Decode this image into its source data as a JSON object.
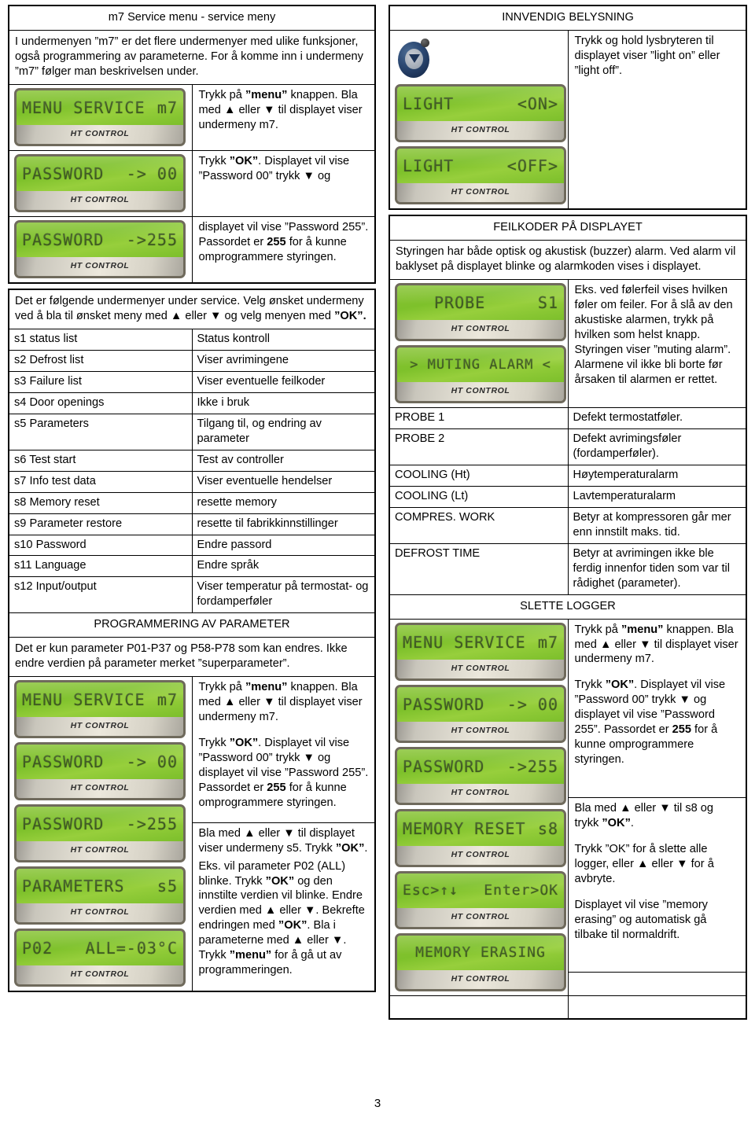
{
  "page_number": "3",
  "left": {
    "section_m7": {
      "title": "m7 Service menu - service meny",
      "intro": "I undermenyen ”m7” er det flere undermenyer med ulike funksjoner, også programmering av parameterne. For å komme inn i undermeny ”m7” følger man beskrivelsen under.",
      "step1_text_a": "Trykk på ",
      "step1_bold": "”menu”",
      "step1_text_b": " knappen. Bla med ▲ eller ▼ til displayet viser undermeny m7.",
      "step2_prefix": "Trykk ",
      "step2_bold": "”OK”",
      "step2_rest": ". Displayet vil vise ”Password 00” trykk ▼ og",
      "step3_a": "displayet vil vise ”Password 255”. Passordet er ",
      "step3_bold": "255",
      "step3_b": " for å kunne omprogrammere styringen.",
      "lcds": [
        {
          "left": "MENU SERVICE",
          "right": "m7",
          "brand": "HT CONTROL"
        },
        {
          "left": "PASSWORD",
          "right": "-> 00",
          "brand": "HT CONTROL"
        },
        {
          "left": "PASSWORD",
          "right": "->255",
          "brand": "HT CONTROL"
        }
      ]
    },
    "submenu_intro_a": "Det er følgende undermenyer under service. Velg ønsket undermeny ved å bla til ønsket meny med  ▲ eller ▼ og velg menyen med ",
    "submenu_intro_bold": "”OK”.",
    "submenu_rows": [
      {
        "code": "s1 status list",
        "desc": "Status kontroll",
        "bold": false
      },
      {
        "code": "s2 Defrost list",
        "desc": "Viser avrimingene",
        "bold": false
      },
      {
        "code": "s3 Failure list",
        "desc": "Viser eventuelle feilkoder",
        "bold": false
      },
      {
        "code": "s4 Door openings",
        "desc": "Ikke i bruk",
        "bold": false
      },
      {
        "code": "s5 Parameters",
        "desc": "Tilgang til, og endring av parameter",
        "bold": true
      },
      {
        "code": "s6 Test start",
        "desc": "Test av controller",
        "bold": false
      },
      {
        "code": "s7 Info test data",
        "desc": "Viser eventuelle hendelser",
        "bold": false
      },
      {
        "code": "s8 Memory reset",
        "desc": "resette memory",
        "bold": false
      },
      {
        "code": "s9 Parameter restore",
        "desc": "resette til fabrikkinnstillinger",
        "bold": false
      },
      {
        "code": "s10 Password",
        "desc": "Endre passord",
        "bold": false
      },
      {
        "code": "s11 Language",
        "desc": "Endre språk",
        "bold": false
      },
      {
        "code": "s12 Input/output",
        "desc": "Viser temperatur på termostat- og fordamperføler",
        "bold": false
      }
    ],
    "prog_title": "PROGRAMMERING AV PARAMETER",
    "prog_intro": "Det er kun parameter P01-P37 og P58-P78 som kan endres. Ikke endre verdien på parameter merket ”superparameter”.",
    "prog_lcds": [
      {
        "left": "MENU SERVICE",
        "right": "m7",
        "brand": "HT CONTROL"
      },
      {
        "left": "PASSWORD",
        "right": "-> 00",
        "brand": "HT CONTROL"
      },
      {
        "left": "PASSWORD",
        "right": "->255",
        "brand": "HT CONTROL"
      },
      {
        "left": "PARAMETERS",
        "right": "s5",
        "brand": "HT CONTROL"
      },
      {
        "left": "P02",
        "right": "ALL=-03°C",
        "brand": "HT CONTROL"
      }
    ],
    "prog_p1_a": "Trykk på ",
    "prog_p1_bold": "”menu”",
    "prog_p1_b": " knappen. Bla med ▲ eller ▼ til displayet viser undermeny m7.",
    "prog_p2_a": "Trykk ",
    "prog_p2_bold": "”OK”",
    "prog_p2_b": ". Displayet vil vise ”Password 00” trykk ▼ og displayet vil vise ”Password 255”. Passordet er ",
    "prog_p2_bold2": "255",
    "prog_p2_c": " for å kunne omprogrammere styringen.",
    "prog_p3_a": "Bla med ▲ eller ▼ til displayet viser undermeny s5. Trykk ",
    "prog_p3_bold": "”OK”",
    "prog_p3_b": ".",
    "prog_p4_a": "Eks. vil parameter P02 (ALL) blinke. Trykk ",
    "prog_p4_bold": "”OK”",
    "prog_p4_b": " og den innstilte verdien vil blinke. Endre verdien med ▲ eller ▼. Bekrefte endringen med ",
    "prog_p4_bold2": "”OK”",
    "prog_p4_c": ". Bla i parameterne med ▲ eller ▼. Trykk ",
    "prog_p4_bold3": "”menu”",
    "prog_p4_d": " for å gå ut av programmeringen."
  },
  "right": {
    "light_title": "INNVENDIG BELYSNING",
    "light_text": "Trykk og hold lysbryteren til displayet viser ”light on” eller ”light off”.",
    "light_icon": "light-switch-icon",
    "light_lcds": [
      {
        "left": "LIGHT",
        "right": "<ON>",
        "brand": "HT CONTROL"
      },
      {
        "left": "LIGHT",
        "right": "<OFF>",
        "brand": "HT CONTROL"
      }
    ],
    "fault_title": "FEILKODER PÅ DISPLAYET",
    "fault_intro": "Styringen har både optisk og akustisk (buzzer) alarm. Ved alarm vil baklyset på displayet blinke og alarmkoden vises i displayet.",
    "fault_lcds": [
      {
        "left": "PROBE",
        "right": "S1",
        "brand": "HT CONTROL"
      },
      {
        "left": "> MUTING ALARM <",
        "right": "",
        "brand": "HT CONTROL",
        "center": true
      }
    ],
    "fault_text": "Eks. ved følerfeil vises hvilken føler om feiler. For å slå av den akustiske alarmen, trykk på hvilken som helst knapp. Styringen viser ”muting alarm”. Alarmene vil ikke bli borte før årsaken til alarmen er rettet.",
    "fault_rows": [
      {
        "code": "PROBE 1",
        "desc": "Defekt termostatføler."
      },
      {
        "code": "PROBE 2",
        "desc": "Defekt avrimingsføler (fordamperføler)."
      },
      {
        "code": "COOLING (Ht)",
        "desc": "Høytemperaturalarm"
      },
      {
        "code": "COOLING (Lt)",
        "desc": "Lavtemperaturalarm"
      },
      {
        "code": "COMPRES. WORK",
        "desc": "Betyr at kompressoren går mer enn innstilt maks. tid."
      },
      {
        "code": "DEFROST TIME",
        "desc": "Betyr at avrimingen ikke ble ferdig innenfor tiden som var til rådighet (parameter)."
      }
    ],
    "log_title": "SLETTE LOGGER",
    "log_lcds": [
      {
        "left": "MENU SERVICE",
        "right": "m7",
        "brand": "HT CONTROL"
      },
      {
        "left": "PASSWORD",
        "right": "-> 00",
        "brand": "HT CONTROL"
      },
      {
        "left": "PASSWORD",
        "right": "->255",
        "brand": "HT CONTROL"
      },
      {
        "left": "MEMORY RESET",
        "right": "s8",
        "brand": "HT CONTROL"
      },
      {
        "left": "Esc>↑↓",
        "right": "Enter>OK",
        "brand": "HT CONTROL"
      },
      {
        "left": "MEMORY ERASING",
        "right": "",
        "brand": "HT CONTROL",
        "center": true
      }
    ],
    "log_p1_a": "Trykk på ",
    "log_p1_bold": "”menu”",
    "log_p1_b": " knappen. Bla med ▲ eller ▼ til displayet viser undermeny m7.",
    "log_p2_a": "Trykk ",
    "log_p2_bold": "”OK”",
    "log_p2_b": ". Displayet vil vise ”Password 00” trykk ▼ og displayet vil vise ”Password 255”. Passordet er ",
    "log_p2_bold2": "255",
    "log_p2_c": " for å kunne omprogrammere styringen.",
    "log_p3_a": "Bla med ▲ eller ▼ til s8 og trykk ",
    "log_p3_bold": "”OK”",
    "log_p3_b": ".",
    "log_p4": "Trykk ”OK” for å slette alle logger, eller ▲ eller ▼ for å avbryte.",
    "log_p5": "Displayet vil vise ”memory erasing” og automatisk gå tilbake til normaldrift."
  }
}
